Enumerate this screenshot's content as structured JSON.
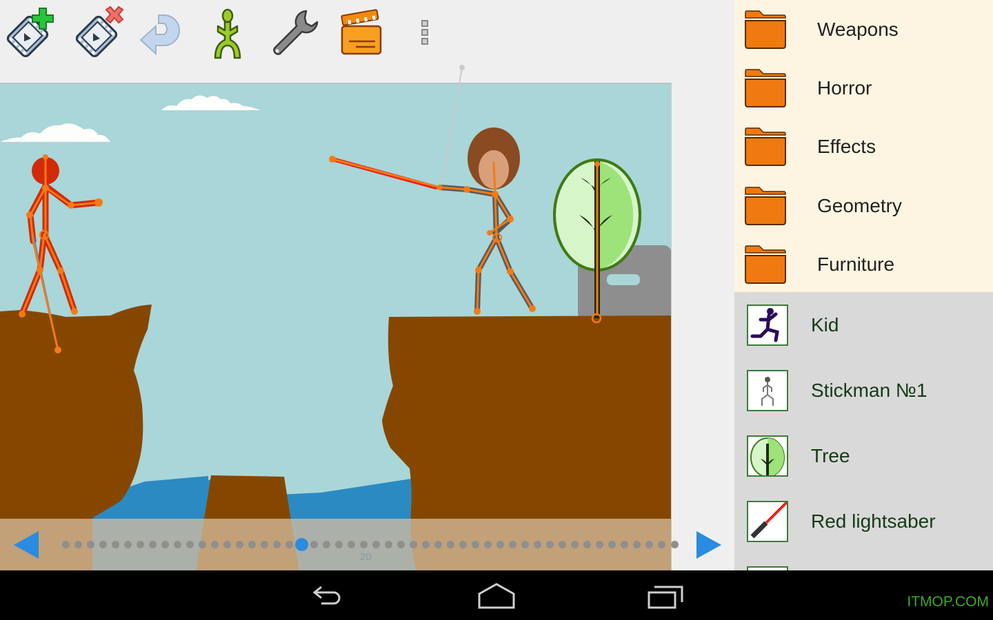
{
  "toolbar": {
    "items": [
      {
        "name": "add-frame",
        "icon": "film-frame-plus-icon"
      },
      {
        "name": "delete-frame",
        "icon": "film-frame-x-icon"
      },
      {
        "name": "undo",
        "icon": "undo-arrow-icon"
      },
      {
        "name": "add-stickman",
        "icon": "stickman-icon"
      },
      {
        "name": "settings",
        "icon": "wrench-icon"
      },
      {
        "name": "play-movie",
        "icon": "clapperboard-icon"
      },
      {
        "name": "overflow-menu",
        "icon": "more-vertical-icon"
      }
    ]
  },
  "timeline": {
    "total_frames": 50,
    "selected_frame_index": 19,
    "frame_label": "20",
    "prev_icon": "arrow-left-icon",
    "next_icon": "arrow-right-icon"
  },
  "sidebar": {
    "folders": [
      {
        "label": "Weapons",
        "icon": "folder-icon"
      },
      {
        "label": "Horror",
        "icon": "folder-icon"
      },
      {
        "label": "Effects",
        "icon": "folder-icon"
      },
      {
        "label": "Geometry",
        "icon": "folder-icon"
      },
      {
        "label": "Furniture",
        "icon": "folder-icon"
      }
    ],
    "objects": [
      {
        "label": "Kid",
        "icon": "running-kid-icon"
      },
      {
        "label": "Stickman №1",
        "icon": "stickman-thumb-icon"
      },
      {
        "label": "Tree",
        "icon": "tree-icon"
      },
      {
        "label": "Red lightsaber",
        "icon": "lightsaber-icon"
      }
    ]
  },
  "colors": {
    "accent": "#2a8be0",
    "folder": "#ee7a10",
    "sky": "#a9d6d8",
    "ground": "#854700",
    "water": "#2b8ac2"
  },
  "navbar": {
    "back_icon": "back-icon",
    "home_icon": "home-icon",
    "recents_icon": "recents-icon",
    "watermark": "ITMOP.COM"
  }
}
